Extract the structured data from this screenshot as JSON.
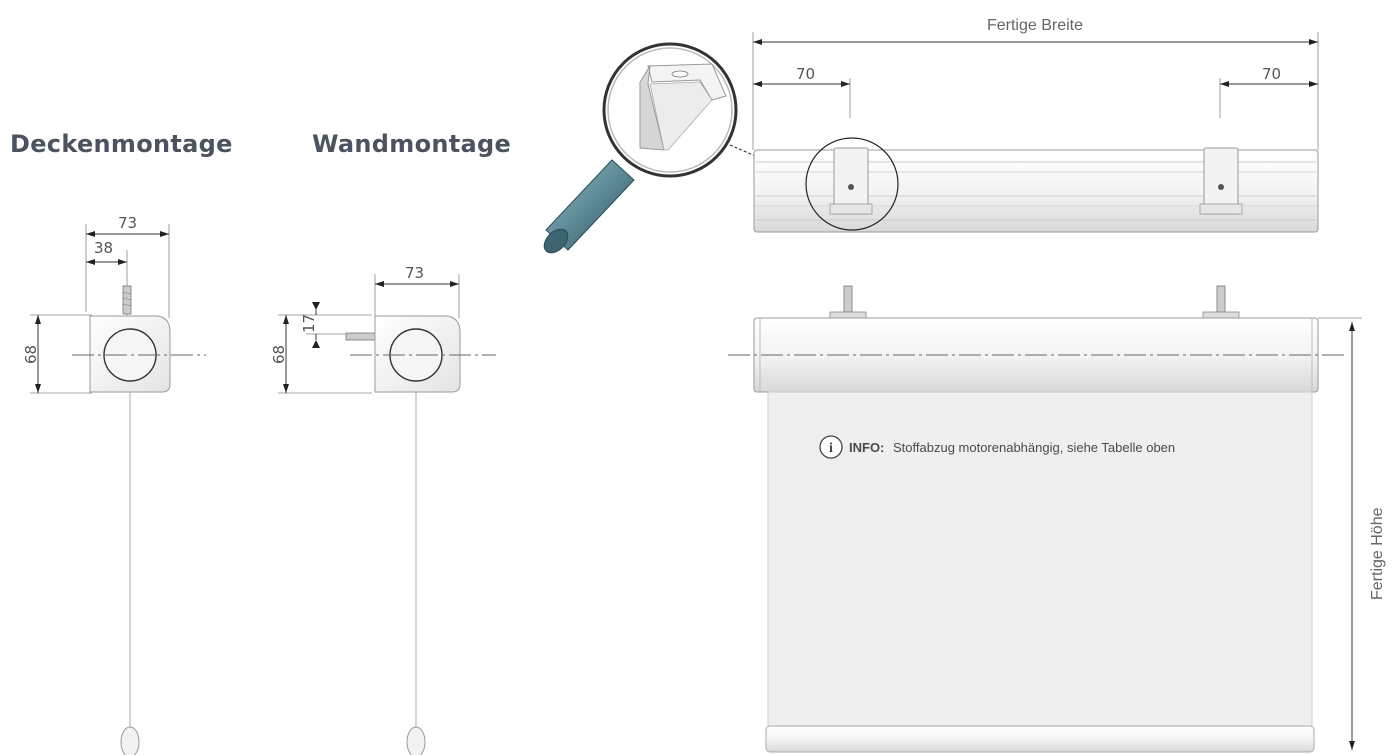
{
  "titles": {
    "ceiling": "Deckenmontage",
    "wall": "Wandmontage"
  },
  "ceiling_dims": {
    "width": "73",
    "offset": "38",
    "height": "68"
  },
  "wall_dims": {
    "width": "73",
    "height": "68",
    "bracket": "17"
  },
  "front_dims": {
    "finished_width": "Fertige Breite",
    "left_bracket": "70",
    "right_bracket": "70",
    "finished_height": "Fertige Höhe"
  },
  "info": {
    "icon": "i",
    "label": "INFO:",
    "text": "Stoffabzug motorenabhängig, siehe Tabelle oben"
  },
  "colors": {
    "title": "#4b5361",
    "fabric": "#efefef",
    "handle": "#5c8a96"
  },
  "icons": {
    "magnifier": "magnifier-icon",
    "info": "info-icon"
  }
}
